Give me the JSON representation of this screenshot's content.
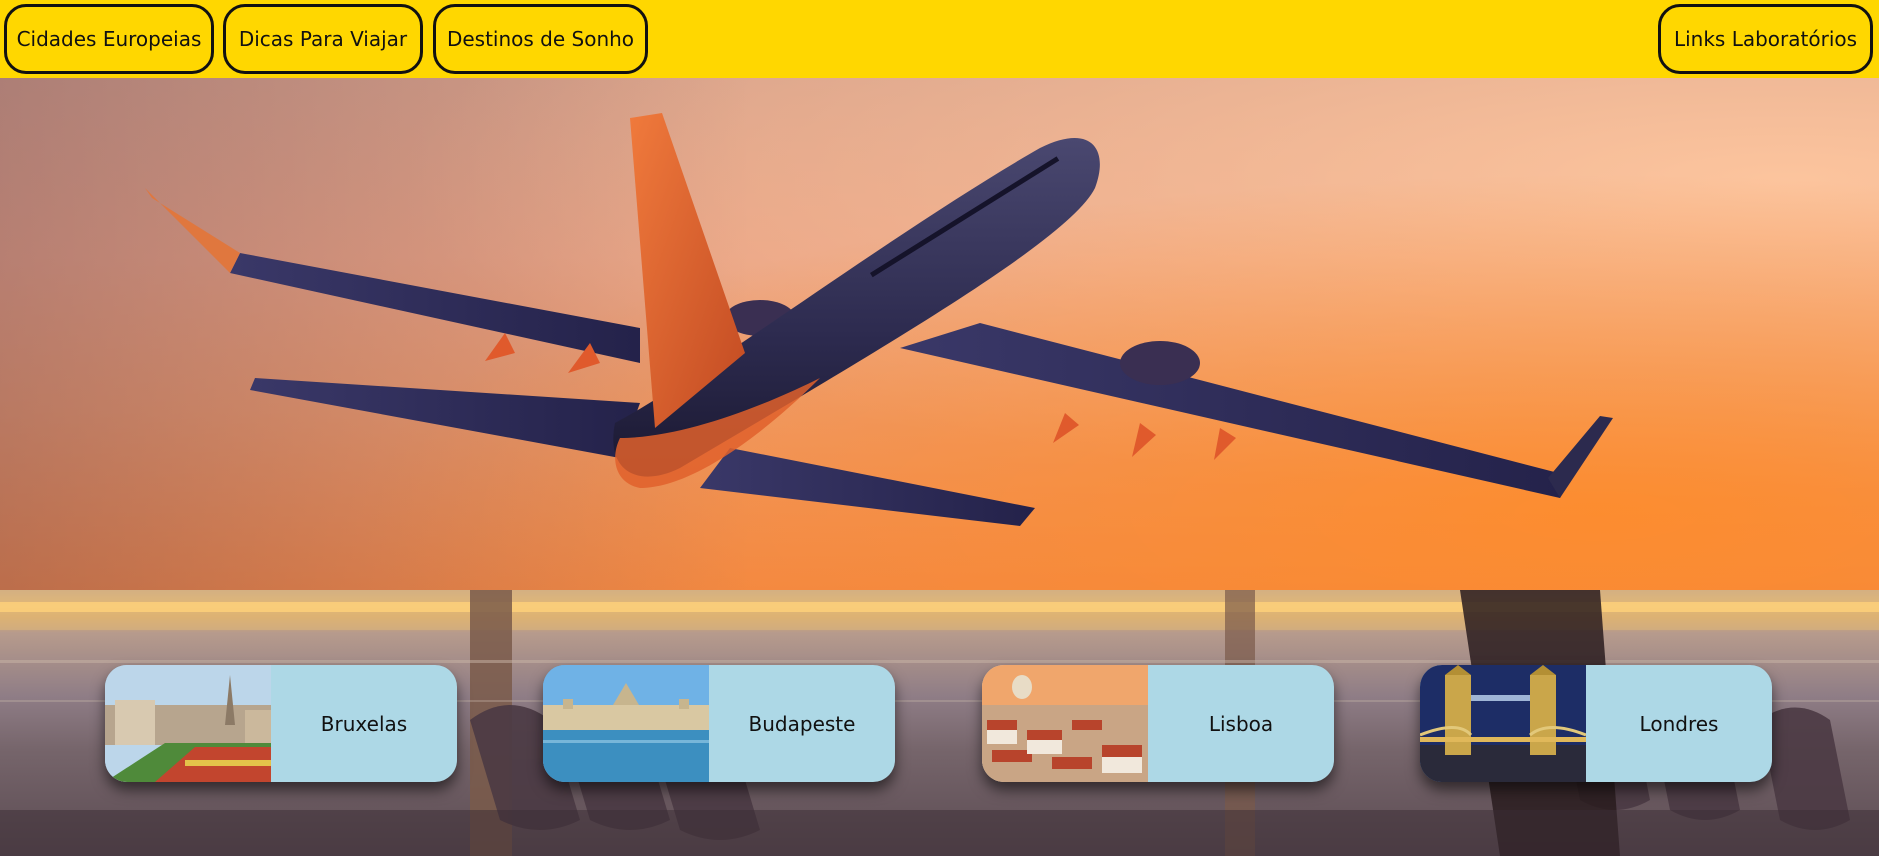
{
  "nav": {
    "left_links": [
      {
        "label": "Cidades Europeias"
      },
      {
        "label": "Dicas Para Viajar"
      },
      {
        "label": "Destinos de Sonho"
      }
    ],
    "right_link": {
      "label": "Links Laboratórios"
    }
  },
  "hero": {
    "image": "airplane-takeoff-sunset"
  },
  "cities": [
    {
      "name": "Bruxelas",
      "image": "bruxelas-grand-place"
    },
    {
      "name": "Budapeste",
      "image": "budapeste-parliament"
    },
    {
      "name": "Lisboa",
      "image": "lisboa-rooftops"
    },
    {
      "name": "Londres",
      "image": "londres-tower-bridge"
    }
  ],
  "background": {
    "image": "airport-lounge-sunset"
  },
  "colors": {
    "navbar": "#FFD700",
    "card": "#ADD8E6",
    "border": "#111111"
  }
}
